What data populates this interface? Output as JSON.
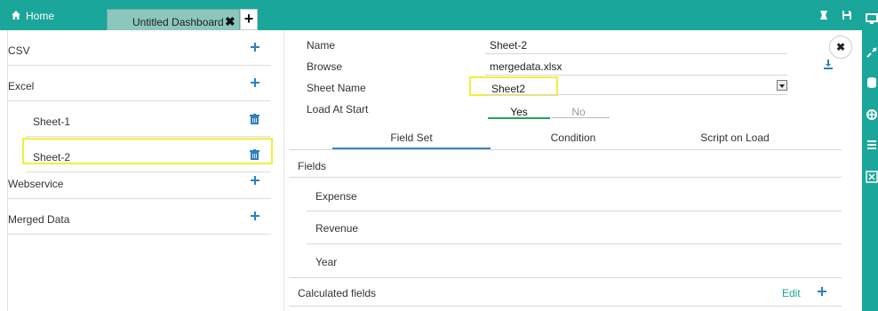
{
  "topbar": {
    "home_label": "Home",
    "tab_label": "Untitled Dashboard",
    "tab_close": "✖",
    "tab_add": "+"
  },
  "left_panel": {
    "items": [
      {
        "label": "CSV",
        "action": "plus-icon"
      },
      {
        "label": "Excel",
        "action": "plus-icon"
      },
      {
        "label": "Sheet-1",
        "action": "trash-icon"
      },
      {
        "label": "Sheet-2",
        "action": "trash-icon",
        "highlighted": true
      },
      {
        "label": "Webservice",
        "action": "plus-icon"
      },
      {
        "label": "Merged Data",
        "action": "plus-icon"
      }
    ]
  },
  "form": {
    "name_label": "Name",
    "name_value": "Sheet-2",
    "browse_label": "Browse",
    "browse_value": "mergedata.xlsx",
    "sheet_label": "Sheet Name",
    "sheet_value": "Sheet2",
    "load_label": "Load At Start",
    "yes": "Yes",
    "no": "No"
  },
  "tabs": [
    "Field Set",
    "Condition",
    "Script on Load"
  ],
  "fields": {
    "header": "Fields",
    "rows": [
      "Expense",
      "Revenue",
      "Year"
    ],
    "calculated": "Calculated fields",
    "edit": "Edit"
  },
  "close_glyph": "✖",
  "colors": {
    "accent": "#1aa69a",
    "highlight": "#f2ee3a",
    "plus": "#2d7fc3"
  }
}
